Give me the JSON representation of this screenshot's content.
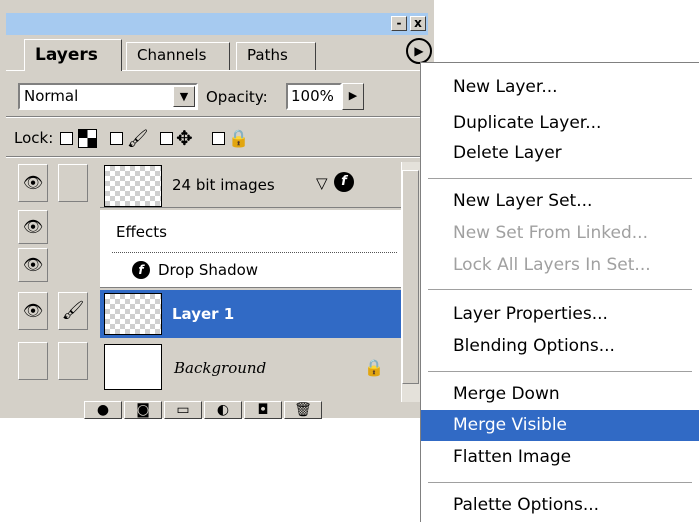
{
  "palette": {
    "tabs": [
      {
        "label": "Layers",
        "active": true
      },
      {
        "label": "Channels",
        "active": false
      },
      {
        "label": "Paths",
        "active": false
      }
    ],
    "window_buttons": {
      "minimize": "-",
      "close": "x"
    },
    "flyout_icon": "right-arrow-circle-icon",
    "blend_mode": "Normal",
    "opacity_label": "Opacity:",
    "opacity_value": "100%",
    "lock_label": "Lock:",
    "lock_options": [
      "transparency-icon",
      "paint-brush-icon",
      "move-icon",
      "lock-icon"
    ],
    "layers": [
      {
        "name": "24 bit images",
        "visible": true,
        "has_effects": true
      },
      {
        "name": "Effects",
        "type": "effects-header"
      },
      {
        "name": "Drop Shadow",
        "type": "effect"
      },
      {
        "name": "Layer 1",
        "visible": true,
        "selected": true,
        "linked_icon": "paint-brush-icon"
      },
      {
        "name": "Background",
        "visible": false,
        "locked": true
      }
    ],
    "bottom_buttons": [
      "effects-icon",
      "mask-icon",
      "new-set-icon",
      "adjustment-layer-icon",
      "new-layer-icon",
      "trash-icon"
    ]
  },
  "menu": {
    "groups": [
      [
        {
          "label": "New Layer...",
          "enabled": true
        },
        {
          "label": "Duplicate Layer...",
          "enabled": true
        },
        {
          "label": "Delete Layer",
          "enabled": true
        }
      ],
      [
        {
          "label": "New Layer Set...",
          "enabled": true
        },
        {
          "label": "New Set From Linked...",
          "enabled": false
        },
        {
          "label": "Lock All Layers In Set...",
          "enabled": false
        }
      ],
      [
        {
          "label": "Layer Properties...",
          "enabled": true
        },
        {
          "label": "Blending Options...",
          "enabled": true
        }
      ],
      [
        {
          "label": "Merge Down",
          "enabled": true
        },
        {
          "label": "Merge Visible",
          "enabled": true,
          "highlighted": true
        },
        {
          "label": "Flatten Image",
          "enabled": true
        }
      ],
      [
        {
          "label": "Palette Options...",
          "enabled": true
        }
      ]
    ]
  },
  "colors": {
    "selection": "#316ac5",
    "titlebar": "#a6caf0",
    "panel": "#d4d0c8"
  }
}
